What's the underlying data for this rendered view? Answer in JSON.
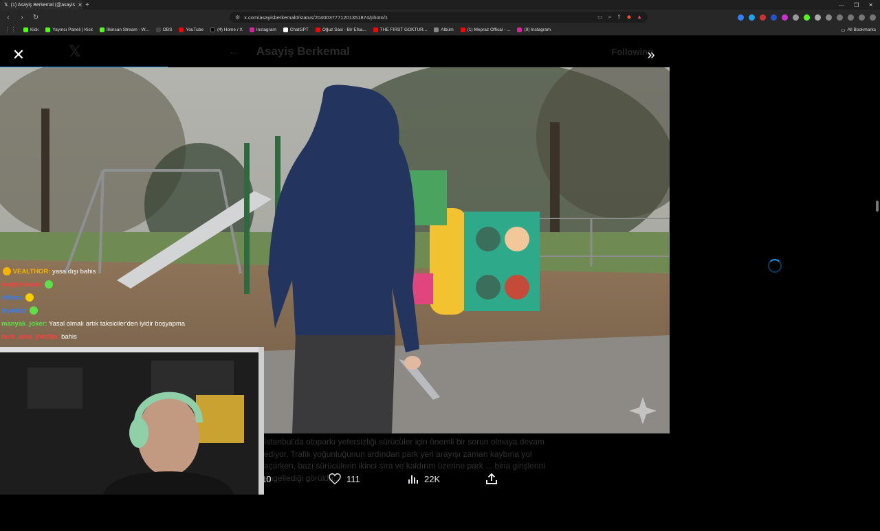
{
  "browser": {
    "tab_title": "(1) Asayiş Berkemal (@asayis",
    "url": "x.com/asayisberkemal0/status/2040037771201351874/photo/1",
    "bookmarks": [
      {
        "label": "Kick",
        "color": "#53fc18"
      },
      {
        "label": "Yayıncı Paneli | Kick",
        "color": "#53fc18"
      },
      {
        "label": "İlkinsan Stream - W...",
        "color": "#53fc18"
      },
      {
        "label": "OBS",
        "color": "#444444"
      },
      {
        "label": "YouTube",
        "color": "#ff0000"
      },
      {
        "label": "(4) Home / X",
        "color": "#000000"
      },
      {
        "label": "Instagram",
        "color": "#d6249f"
      },
      {
        "label": "ChatGPT",
        "color": "#ffffff"
      },
      {
        "label": "Oğuz Sasi - Bir Efsa...",
        "color": "#ff0000"
      },
      {
        "label": "THE FIRST GOKTUR...",
        "color": "#ff0000"
      },
      {
        "label": "Albüm",
        "color": "#888888"
      },
      {
        "label": "(1) Mepraz Offical - ...",
        "color": "#ff0000"
      },
      {
        "label": "(9) Instagram",
        "color": "#d6249f"
      }
    ],
    "all_bookmarks": "All Bookmarks"
  },
  "viewer": {
    "bg_name": "Asayiş Berkemal",
    "bg_follow": "Following",
    "progress": 0.25,
    "close_icon": "close-icon",
    "expand_icon": "expand-icon"
  },
  "tweet": {
    "text": "İstanbul'da otoparkı yetersizliği sürücüler için önemli bir sorun olmaya devam ediyor. Trafik yoğunluğunun ardından park yeri arayışı zaman kaybına yol açarken, bazı sürücülerin ikinci sıra ve kaldırım üzerine park ... bina girişlerini engellediği görüldü.",
    "replies": "10",
    "likes": "111",
    "views": "22K"
  },
  "chat": [
    {
      "user": "VEALTHOR:",
      "msg": "yasa dışı bahis",
      "color": "#f5b400"
    },
    {
      "user": "koqtelickadir",
      "msg": "",
      "color": "#ff3d3d"
    },
    {
      "user": "nMuco",
      "msg": "",
      "color": "#2f7fff"
    },
    {
      "user": "biyakizz",
      "msg": "",
      "color": "#2f7fff"
    },
    {
      "user": "manyak_joker:",
      "msg": "Yasal olmalı artık taksiciler'den iyidir boşyapma",
      "color": "#5fe04a"
    },
    {
      "user": "berk_ama_jokzilla:",
      "msg": "bahis",
      "color": "#ff3d3d"
    }
  ]
}
